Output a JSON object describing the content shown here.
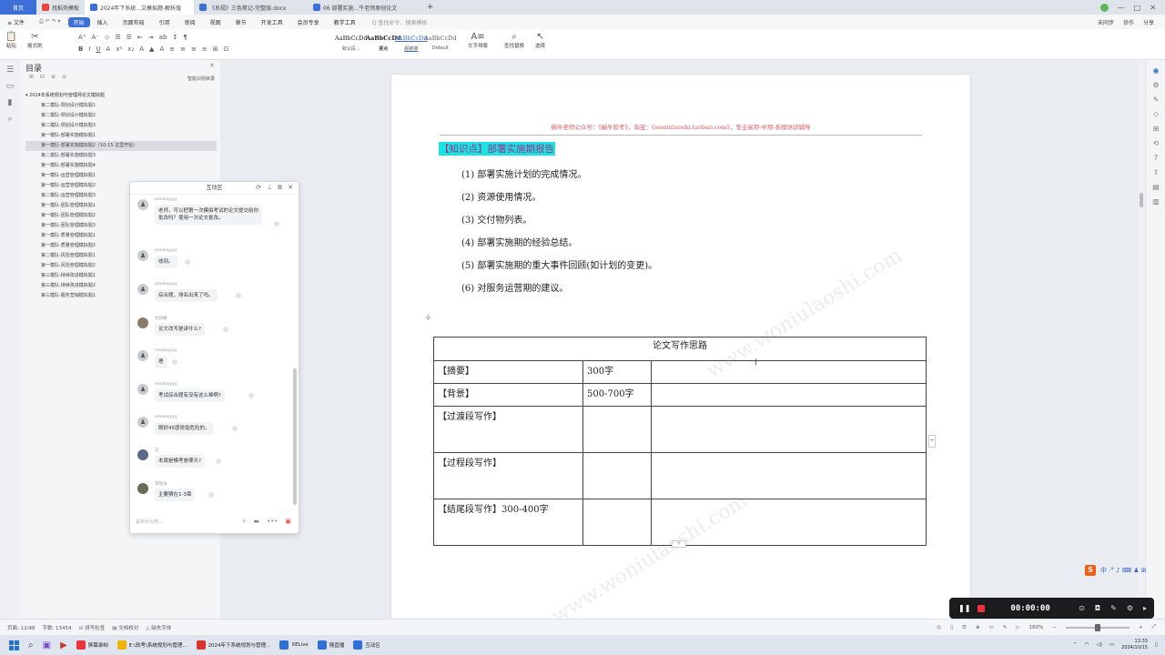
{
  "tabs": {
    "home": "首页",
    "items": [
      {
        "label": "找稻壳模板",
        "color": "#e8453c"
      },
      {
        "label": "2024年下系统...文模拟题-解析版",
        "color": "#3d6fd8"
      },
      {
        "label": "《系规》三色笔记-完整版.docx",
        "color": "#3d6fd8"
      },
      {
        "label": "06 部署实施...牛老师原创论文",
        "color": "#3d6fd8"
      }
    ],
    "new_tab": "+"
  },
  "menu": {
    "file": "≡ 文件",
    "items": [
      "开始",
      "插入",
      "页面布局",
      "引用",
      "审阅",
      "视图",
      "章节",
      "开发工具",
      "会员专享",
      "教学工具"
    ],
    "active": "开始",
    "search_placeholder": "Q 查找命令、搜索模板",
    "right": [
      "未同步",
      "协作",
      "分享"
    ]
  },
  "ribbon": {
    "paste": "粘贴",
    "format_painter": "格式刷",
    "styles": [
      {
        "sample": "AaBbCcDd",
        "label": "默认段..."
      },
      {
        "sample": "AaBbCcDd",
        "label": "要点"
      },
      {
        "sample": "AaBbCcDd",
        "label": "超链接"
      },
      {
        "sample": "AaBbCcDd",
        "label": "Default"
      }
    ],
    "text_layout": "文字排版",
    "find_replace": "查找替换",
    "select": "选择"
  },
  "toc": {
    "title": "目录",
    "smart_label": "智能识别目录",
    "root": "2024年系统规划与管理师论文模拟题",
    "items": [
      "第二模队-规划设计模拟题1",
      "第二模队-规划设计模拟题2",
      "第二模队-规划设计模拟题3",
      "第一模队-部署实施模拟题1",
      "第一模队-部署实施模拟题2（10-15 这里开始）",
      "第二模队-部署实施模拟题3",
      "第一模队-部署实施模拟题4",
      "第一模队-运营管理模拟题1",
      "第一模队-运营管理模拟题2",
      "第二模队-运营管理模拟题3",
      "第一模队-团队管理模拟题1",
      "第一模队-团队管理模拟题2",
      "第一模队-团队管理模拟题3",
      "第一模队-质量管理模拟题1",
      "第一模队-质量管理模拟题2",
      "第二模队-风险管理模拟题1",
      "第一模队-风险管理模拟题2",
      "第三模队-持续改进模拟题1",
      "第三模队-持续改进模拟题2",
      "第三模队-服务营销模拟题1"
    ],
    "active_index": 4
  },
  "document": {
    "header": "蜗牛老师公众号：《蜗牛软考》，淘宝：《woniulaoshi.taobao.com》，专业高项-中项-系规培训辅导",
    "knowledge_title": "【知识点】部署实施期报告",
    "points": [
      "(1) 部署实施计划的完成情况。",
      "(2) 资源使用情况。",
      "(3) 交付物列表。",
      "(4) 部署实施期的经验总结。",
      "(5) 部署实施期的重大事件回顾(如计划的变更)。",
      "(6) 对服务运营期的建议。"
    ],
    "table": {
      "title": "论文写作思路",
      "rows": [
        [
          "【摘要】",
          "300字",
          ""
        ],
        [
          "【背景】",
          "500-700字",
          ""
        ],
        [
          "【过渡段写作】",
          "",
          ""
        ],
        [
          "【过程段写作】",
          "",
          ""
        ],
        [
          "【结尾段写作】300-400字",
          "",
          ""
        ]
      ]
    },
    "watermark": "www.woniulaoshi.com"
  },
  "chat": {
    "title": "互动区",
    "messages": [
      {
        "user": "oreoloyyyy",
        "text": "老师，可以把第一次模拟考试的论文提交给你批改吗？使用一次论文批改。"
      },
      {
        "user": "oreoloyyyy",
        "text": "收到。"
      },
      {
        "user": "oreoloyyyy",
        "text": "综合题，排名出来了吗。"
      },
      {
        "user": "杜新娜",
        "text": "论文改写是讲什么?"
      },
      {
        "user": "oreoloyyyy",
        "text": "嗯"
      },
      {
        "user": "oreoloyyyy",
        "text": "考试综合题有没有这么难啊?"
      },
      {
        "user": "oreoloyyyy",
        "text": "刚好45感觉挺危险的。"
      },
      {
        "user": "向",
        "text": "本周是模考是哪天?"
      },
      {
        "user": "李晓涛",
        "text": "主要猜在1-3章"
      }
    ],
    "input_placeholder": "说点什么吧..."
  },
  "recorder": {
    "time": "00:00:00"
  },
  "ime": {
    "logo": "S",
    "label": "中 ·° ♪ ⌨ ♟ ⊞"
  },
  "status": {
    "page": "页面: 12/48",
    "words": "字数: 13454",
    "spell": "拼写检查",
    "doc_check": "文档校对",
    "missing_font": "缺失字体",
    "zoom": "160%"
  },
  "taskbar": {
    "apps": [
      {
        "label": "屏幕录制",
        "color": "#e8343a"
      },
      {
        "label": "E:\\软考\\系统规划与管理...",
        "color": "#f0b400"
      },
      {
        "label": "2024年下系统规划与管理...",
        "color": "#d9342b"
      },
      {
        "label": "XELive",
        "color": "#2f6fd6"
      },
      {
        "label": "随直播",
        "color": "#2f6fd6"
      },
      {
        "label": "互动区",
        "color": "#2f6fd6"
      }
    ],
    "time": "13:33",
    "date": "2024/10/15"
  }
}
